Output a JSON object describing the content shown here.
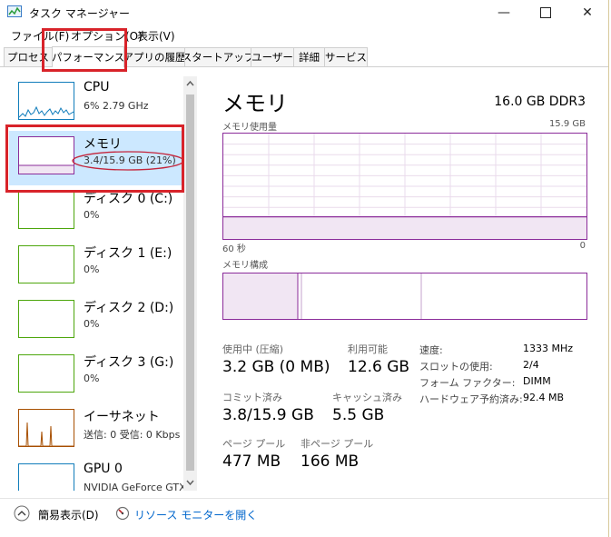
{
  "window": {
    "title": "タスク マネージャー",
    "min_icon": "minimize-icon",
    "max_icon": "maximize-icon",
    "close_icon": "close-icon"
  },
  "menu": [
    "ファイル(F)",
    "オプション(O)",
    "表示(V)"
  ],
  "tabs": [
    "プロセス",
    "パフォーマンス",
    "アプリの履歴",
    "スタートアップ",
    "ユーザー",
    "詳細",
    "サービス"
  ],
  "active_tab": "パフォーマンス",
  "sidebar": {
    "items": [
      {
        "name": "CPU",
        "sub": "6%  2.79 GHz",
        "color": "#117dbb"
      },
      {
        "name": "メモリ",
        "sub": "3.4/15.9 GB (21%)",
        "color": "#8b2c9a"
      },
      {
        "name": "ディスク 0 (C:)",
        "sub": "0%",
        "color": "#4da60c"
      },
      {
        "name": "ディスク 1 (E:)",
        "sub": "0%",
        "color": "#4da60c"
      },
      {
        "name": "ディスク 2 (D:)",
        "sub": "0%",
        "color": "#4da60c"
      },
      {
        "name": "ディスク 3 (G:)",
        "sub": "0%",
        "color": "#4da60c"
      },
      {
        "name": "イーサネット",
        "sub": "送信: 0  受信: 0 Kbps",
        "color": "#a74f01"
      },
      {
        "name": "GPU 0",
        "sub": "NVIDIA GeForce GTX",
        "color": "#117dbb"
      }
    ]
  },
  "main": {
    "title": "メモリ",
    "capacity": "16.0 GB DDR3",
    "usage_label": "メモリ使用量",
    "usage_max": "15.9 GB",
    "time_left": "60 秒",
    "time_right": "0",
    "composition_label": "メモリ構成",
    "usage_fraction": 0.21
  },
  "stats": {
    "in_use_label": "使用中 (圧縮)",
    "in_use_value": "3.2 GB (0 MB)",
    "available_label": "利用可能",
    "available_value": "12.6 GB",
    "committed_label": "コミット済み",
    "committed_value": "3.8/15.9 GB",
    "cached_label": "キャッシュ済み",
    "cached_value": "5.5 GB",
    "paged_label": "ページ プール",
    "paged_value": "477 MB",
    "nonpaged_label": "非ページ プール",
    "nonpaged_value": "166 MB"
  },
  "details": [
    {
      "k": "速度:",
      "v": "1333 MHz"
    },
    {
      "k": "スロットの使用:",
      "v": "2/4"
    },
    {
      "k": "フォーム ファクター:",
      "v": "DIMM"
    },
    {
      "k": "ハードウェア予約済み:",
      "v": "92.4 MB"
    }
  ],
  "footer": {
    "fewer_details": "簡易表示(D)",
    "resource_monitor": "リソース モニターを開く"
  }
}
